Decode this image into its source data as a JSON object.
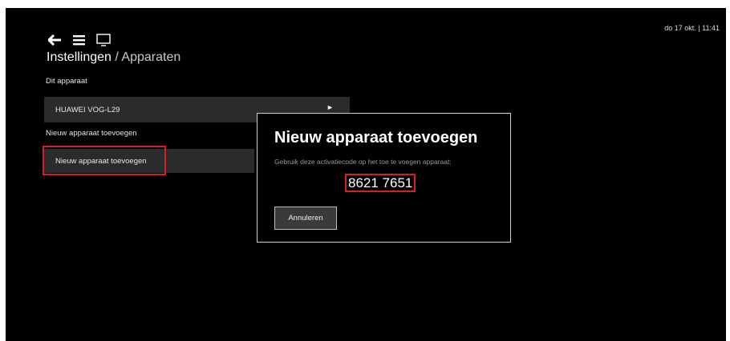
{
  "status": {
    "datetime": "do 17 okt. | 11:41"
  },
  "header": {
    "breadcrumb_main": "Instellingen",
    "breadcrumb_separator": " / ",
    "breadcrumb_sub": "Apparaten",
    "icons": [
      "back-arrow-icon",
      "menu-icon",
      "tv-icon"
    ]
  },
  "sections": {
    "this_device_label": "Dit apparaat",
    "this_device_name": "HUAWEI VOG-L29",
    "this_device_action_glyph": "►",
    "add_device_label": "Nieuw apparaat toevoegen",
    "add_device_button": "Nieuw apparaat toevoegen"
  },
  "dialog": {
    "title": "Nieuw apparaat toevoegen",
    "subtitle": "Gebruik deze activatiecode op het toe te voegen apparaat:",
    "code": "8621 7651",
    "cancel_label": "Annuleren"
  },
  "colors": {
    "background": "#000000",
    "row": "#2b2b2b",
    "focus_highlight": "#d32025",
    "dialog_border": "#cfcfcf"
  }
}
